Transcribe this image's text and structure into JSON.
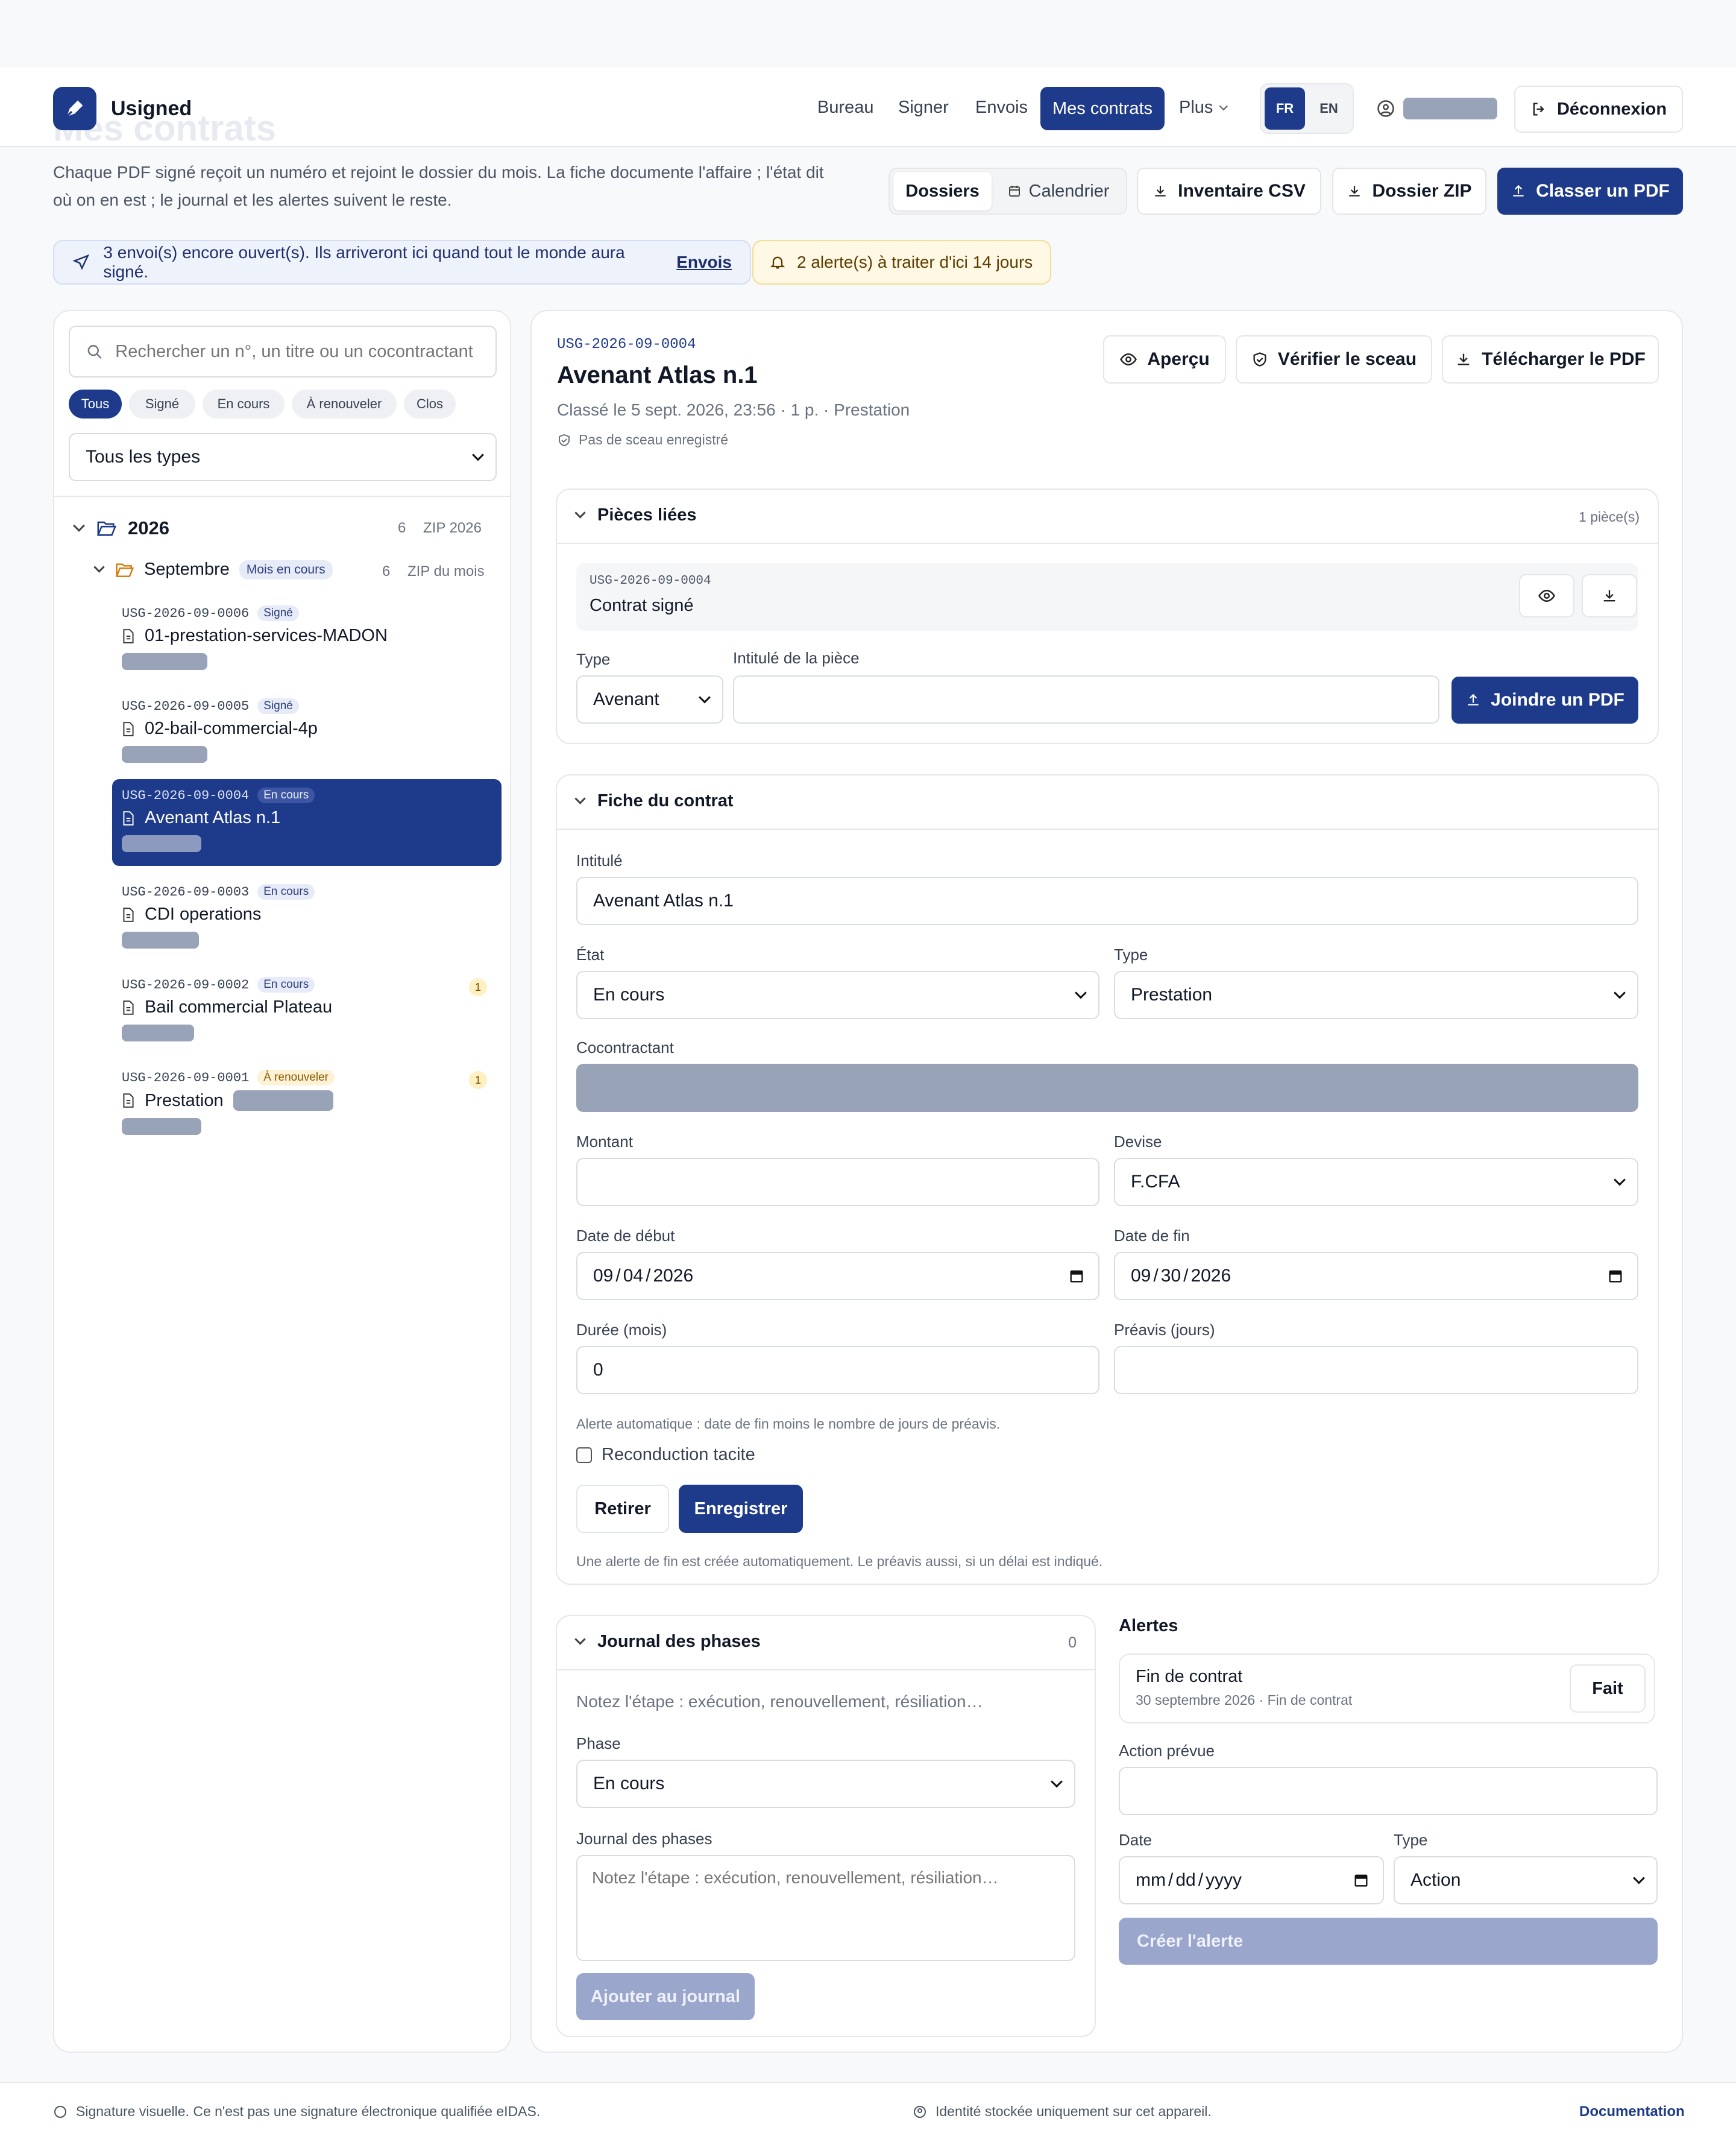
{
  "app": {
    "name": "Usigned",
    "ghost_title": "Mes contrats"
  },
  "nav": {
    "items": [
      "Bureau",
      "Signer",
      "Envois",
      "Mes contrats",
      "Plus"
    ],
    "active": "Mes contrats",
    "lang": [
      "FR",
      "EN"
    ],
    "logout": "Déconnexion"
  },
  "intro": {
    "line1": "Chaque PDF signé reçoit un numéro et rejoint le dossier du mois. La fiche documente l'affaire ; l'état dit",
    "line2": "où on en est ; le journal et les alertes suivent le reste."
  },
  "toolbar": {
    "dossiers": "Dossiers",
    "calendrier": "Calendrier",
    "csv": "Inventaire CSV",
    "zip": "Dossier ZIP",
    "classer": "Classer un PDF"
  },
  "banners": {
    "envois_text": "3 envoi(s) encore ouvert(s). Ils arriveront ici quand tout le monde aura signé.",
    "envois_link": "Envois",
    "alerts": "2 alerte(s) à traiter d'ici 14 jours"
  },
  "sidebar": {
    "search_placeholder": "Rechercher un n°, un titre ou un cocontractant",
    "filters": [
      "Tous",
      "Signé",
      "En cours",
      "À renouveler",
      "Clos"
    ],
    "type_select": "Tous les types",
    "year": {
      "label": "2026",
      "count": "6",
      "zip": "ZIP 2026"
    },
    "month": {
      "label": "Septembre",
      "badge": "Mois en cours",
      "count": "6",
      "zip": "ZIP du mois"
    },
    "items": [
      {
        "id": "USG-2026-09-0006",
        "status": "Signé",
        "title": "01-prestation-services-MADON",
        "alerts": ""
      },
      {
        "id": "USG-2026-09-0005",
        "status": "Signé",
        "title": "02-bail-commercial-4p",
        "alerts": ""
      },
      {
        "id": "USG-2026-09-0004",
        "status": "En cours",
        "title": "Avenant Atlas n.1",
        "alerts": ""
      },
      {
        "id": "USG-2026-09-0003",
        "status": "En cours",
        "title": "CDI operations",
        "alerts": ""
      },
      {
        "id": "USG-2026-09-0002",
        "status": "En cours",
        "title": "Bail commercial Plateau",
        "alerts": "1"
      },
      {
        "id": "USG-2026-09-0001",
        "status": "À renouveler",
        "title": "Prestation",
        "alerts": "1"
      }
    ]
  },
  "detail": {
    "id": "USG-2026-09-0004",
    "title": "Avenant Atlas n.1",
    "meta": "Classé le 5 sept. 2026, 23:56 · 1 p. · Prestation",
    "seal": "Pas de sceau enregistré",
    "actions": {
      "apercu": "Aperçu",
      "verifier": "Vérifier le sceau",
      "telecharger": "Télécharger le PDF"
    }
  },
  "pieces": {
    "title": "Pièces liées",
    "count": "1 pièce(s)",
    "item_id": "USG-2026-09-0004",
    "item_title": "Contrat signé",
    "type_label": "Type",
    "type_value": "Avenant",
    "intitule_label": "Intitulé de la pièce",
    "intitule_value": "",
    "joindre": "Joindre un PDF"
  },
  "fiche": {
    "title": "Fiche du contrat",
    "intitule_label": "Intitulé",
    "intitule_value": "Avenant Atlas n.1",
    "etat_label": "État",
    "etat_value": "En cours",
    "type_label": "Type",
    "type_value": "Prestation",
    "cocontractant_label": "Cocontractant",
    "montant_label": "Montant",
    "montant_value": "",
    "devise_label": "Devise",
    "devise_value": "F.CFA",
    "debut_label": "Date de début",
    "debut_value": [
      "09",
      "04",
      "2026"
    ],
    "fin_label": "Date de fin",
    "fin_value": [
      "09",
      "30",
      "2026"
    ],
    "duree_label": "Durée (mois)",
    "duree_value": "0",
    "preavis_label": "Préavis (jours)",
    "preavis_value": "",
    "hint": "Alerte automatique : date de fin moins le nombre de jours de préavis.",
    "tacite": "Reconduction tacite",
    "retirer": "Retirer",
    "enregistrer": "Enregistrer",
    "note": "Une alerte de fin est créée automatiquement. Le préavis aussi, si un délai est indiqué."
  },
  "journal": {
    "title": "Journal des phases",
    "count": "0",
    "empty": "Notez l'étape : exécution, renouvellement, résiliation…",
    "phase_label": "Phase",
    "phase_value": "En cours",
    "journal_label": "Journal des phases",
    "placeholder": "Notez l'étape : exécution, renouvellement, résiliation…",
    "add": "Ajouter au journal"
  },
  "alertes": {
    "title": "Alertes",
    "item_title": "Fin de contrat",
    "item_meta": "30 septembre 2026 · Fin de contrat",
    "fait": "Fait",
    "action_label": "Action prévue",
    "date_label": "Date",
    "date_placeholder": [
      "mm",
      "dd",
      "yyyy"
    ],
    "type_label": "Type",
    "type_value": "Action",
    "create": "Créer l'alerte"
  },
  "footer": {
    "left": "Signature visuelle. Ce n'est pas une signature électronique qualifiée eIDAS.",
    "center": "Identité stockée uniquement sur cet appareil.",
    "right": "Documentation"
  },
  "colors": {
    "accent": "#1e3a8a",
    "disabled": "#9aa6cc",
    "warn_bg": "#fef8e4"
  }
}
